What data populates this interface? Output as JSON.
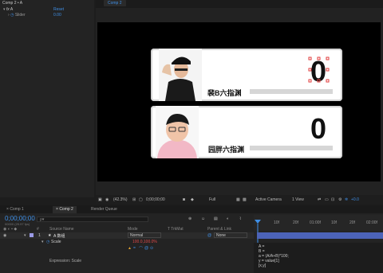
{
  "effect_controls": {
    "breadcrumb": "Comp 2 • A",
    "fx_label": "A",
    "reset_label": "Reset",
    "slider_label": "Slider",
    "slider_value": "0.00"
  },
  "viewer": {
    "tab": "Comp 2",
    "card1": {
      "name": "裴B六指渊",
      "value": "0"
    },
    "card2": {
      "name": "园胖六指渊",
      "value": "0"
    },
    "toolbar": {
      "zoom": "(42.3%)",
      "timecode": "0;00;00;00",
      "resolution": "Full",
      "camera": "Active Camera",
      "view": "1 View",
      "exposure": "+0.0"
    }
  },
  "timeline": {
    "tabs": [
      "Comp 1",
      "Comp 2",
      "Render Queue"
    ],
    "timecode": "0;00;00;00",
    "timecode_sub": "00000 (29.97 fps)",
    "search_placeholder": "ρ▾",
    "columns": {
      "source": "Source Name",
      "mode": "Mode",
      "trkmat": "T TrkMat",
      "parent": "Parent & Link"
    },
    "layer": {
      "index": "1",
      "name": "A 数组",
      "mode": "Normal",
      "parent": "None"
    },
    "property": {
      "name": "Scale",
      "value": "100.0,100.0%"
    },
    "expression_label": "Expression: Scale",
    "ruler_ticks": [
      "10f",
      "20f",
      "01:00f",
      "10f",
      "20f",
      "02:00f"
    ],
    "code_lines": [
      "A =",
      "B =",
      "a = (A/A+B)*100;",
      "y = value[1]",
      "[x,y]"
    ]
  }
}
